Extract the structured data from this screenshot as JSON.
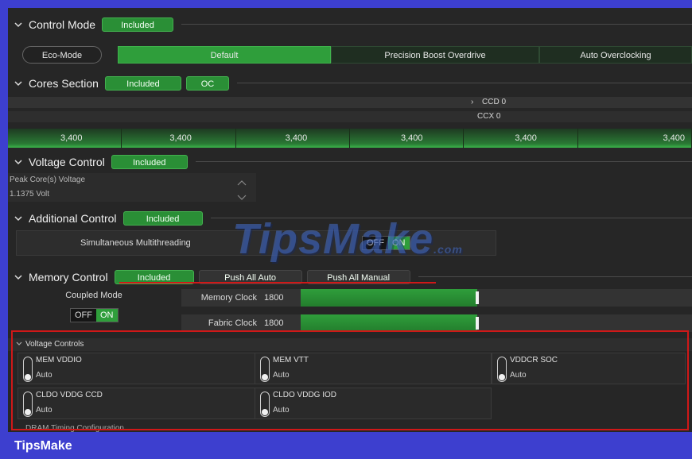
{
  "control_mode": {
    "title": "Control Mode",
    "badge": "Included",
    "modes": [
      "Eco-Mode",
      "Default",
      "Precision Boost Overdrive",
      "Auto Overclocking"
    ],
    "active_mode": "Default"
  },
  "cores_section": {
    "title": "Cores Section",
    "badge": "Included",
    "badge2": "OC",
    "ccd_label": "CCD 0",
    "ccx_label": "CCX 0",
    "freqs": [
      "3,400",
      "3,400",
      "3,400",
      "3,400",
      "3,400",
      "3,400"
    ]
  },
  "voltage_control": {
    "title": "Voltage Control",
    "badge": "Included",
    "field_label": "Peak Core(s) Voltage",
    "field_value": "1.1375 Volt"
  },
  "additional_control": {
    "title": "Additional Control",
    "badge": "Included",
    "smt_label": "Simultaneous Multithreading",
    "toggle_off": "OFF",
    "toggle_on": "ON"
  },
  "memory_control": {
    "title": "Memory Control",
    "badge": "Included",
    "push_auto": "Push All Auto",
    "push_manual": "Push All Manual",
    "coupled_label": "Coupled Mode",
    "toggle_off": "OFF",
    "toggle_on": "ON",
    "memory_clock_label": "Memory Clock",
    "memory_clock_value": "1800",
    "fabric_clock_label": "Fabric Clock",
    "fabric_clock_value": "1800"
  },
  "voltage_controls": {
    "title": "Voltage Controls",
    "items": [
      {
        "name": "MEM VDDIO",
        "value": "Auto"
      },
      {
        "name": "MEM VTT",
        "value": "Auto"
      },
      {
        "name": "VDDCR SOC",
        "value": "Auto"
      },
      {
        "name": "CLDO VDDG CCD",
        "value": "Auto"
      },
      {
        "name": "CLDO VDDG IOD",
        "value": "Auto"
      }
    ]
  },
  "dram_timing": {
    "title": "DRAM Timing Configuration"
  },
  "watermark": {
    "text": "TipsMake",
    "suffix": ".com"
  },
  "footer": {
    "brand": "TipsMake"
  },
  "colors": {
    "accent": "#2f9e3b",
    "highlight": "#d01818",
    "frame": "#3d3fcf"
  }
}
